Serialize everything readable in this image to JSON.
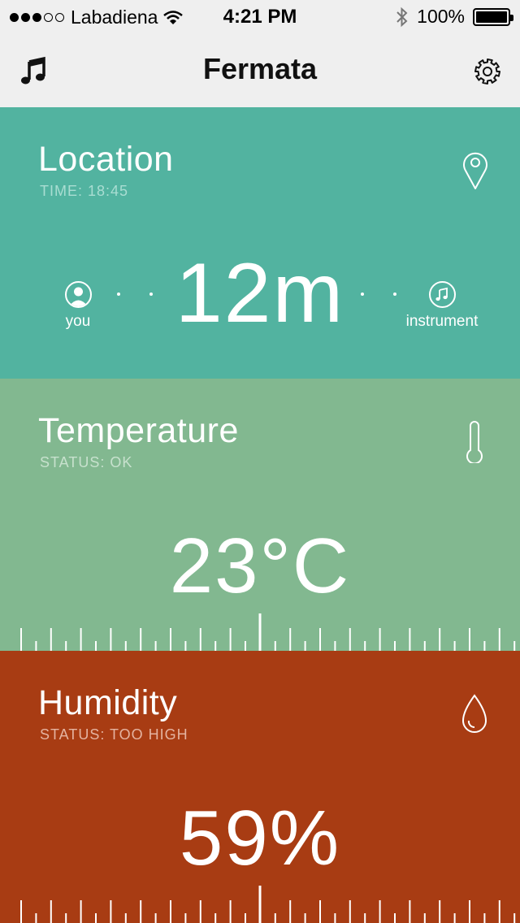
{
  "status_bar": {
    "signal_dots": [
      true,
      true,
      true,
      false,
      false
    ],
    "carrier": "Labadiena",
    "time": "4:21 PM",
    "battery": "100%",
    "battery_level": 1.0
  },
  "nav": {
    "title": "Fermata",
    "left_icon": "music-note-icon",
    "right_icon": "gear-icon"
  },
  "location": {
    "title": "Location",
    "subtitle": "TIME: 18:45",
    "distance": "12m",
    "from_label": "you",
    "to_label": "instrument",
    "icon": "map-pin-icon",
    "color": "#52b3a0"
  },
  "temperature": {
    "title": "Temperature",
    "subtitle": "STATUS: OK",
    "value": "23°C",
    "icon": "thermometer-icon",
    "color": "#82b890"
  },
  "humidity": {
    "title": "Humidity",
    "subtitle": "STATUS: TOO HIGH",
    "value": "59%",
    "icon": "water-drop-icon",
    "color": "#a83c13"
  }
}
